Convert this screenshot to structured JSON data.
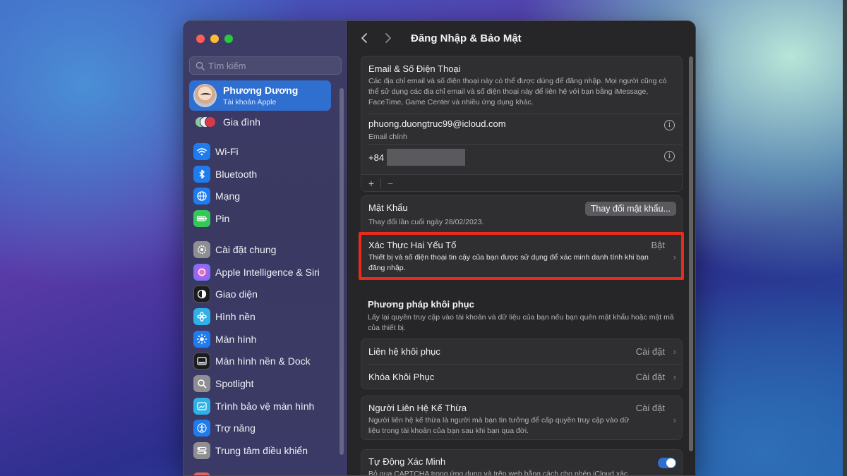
{
  "window": {
    "title": "Đăng Nhập & Bảo Mật"
  },
  "sidebar": {
    "search_placeholder": "Tìm kiếm",
    "account": {
      "name": "Phương Dương",
      "subtitle": "Tài khoản Apple"
    },
    "family_label": "Gia đình",
    "items": [
      {
        "label": "Wi-Fi",
        "icon": "wifi-icon"
      },
      {
        "label": "Bluetooth",
        "icon": "bluetooth-icon"
      },
      {
        "label": "Mạng",
        "icon": "globe-icon"
      },
      {
        "label": "Pin",
        "icon": "battery-icon"
      },
      {
        "label": "Cài đặt chung",
        "icon": "gear-icon"
      },
      {
        "label": "Apple Intelligence & Siri",
        "icon": "siri-icon"
      },
      {
        "label": "Giao diện",
        "icon": "appearance-icon"
      },
      {
        "label": "Hình nền",
        "icon": "wallpaper-icon"
      },
      {
        "label": "Màn hình",
        "icon": "display-icon"
      },
      {
        "label": "Màn hình nền & Dock",
        "icon": "dock-icon"
      },
      {
        "label": "Spotlight",
        "icon": "spotlight-icon"
      },
      {
        "label": "Trình bảo vệ màn hình",
        "icon": "screensaver-icon"
      },
      {
        "label": "Trợ năng",
        "icon": "accessibility-icon"
      },
      {
        "label": "Trung tâm điều khiển",
        "icon": "control-center-icon"
      }
    ]
  },
  "email_section": {
    "title": "Email & Số Điện Thoại",
    "description": "Các địa chỉ email và số điện thoại này có thể được dùng để đăng nhập. Mọi người cũng có thể sử dụng các địa chỉ email và số điện thoại này để liên hệ với bạn bằng iMessage, FaceTime, Game Center và nhiều ứng dụng khác.",
    "email": "phuong.duongtruc99@icloud.com",
    "email_label": "Email chính",
    "phone_prefix": "+84",
    "add": "+",
    "remove": "−"
  },
  "password": {
    "title": "Mật Khẩu",
    "description": "Thay đổi lần cuối ngày 28/02/2023.",
    "button": "Thay đổi mật khẩu..."
  },
  "two_factor": {
    "title": "Xác Thực Hai Yếu Tố",
    "status": "Bật",
    "description": "Thiết bị và số điện thoại tin cậy của bạn được sử dụng để xác minh danh tính khi bạn đăng nhập."
  },
  "recovery": {
    "title": "Phương pháp khôi phục",
    "description": "Lấy lại quyền truy cập vào tài khoản và dữ liệu của bạn nếu bạn quên mật khẩu hoặc mật mã của thiết bị.",
    "contact_label": "Liên hệ khôi phục",
    "contact_value": "Cài đặt",
    "key_label": "Khóa Khôi Phục",
    "key_value": "Cài đặt"
  },
  "legacy": {
    "title": "Người Liên Hệ Kế Thừa",
    "value": "Cài đặt",
    "description": "Người liên hệ kế thừa là người mà bạn tin tưởng để cấp quyền truy cập vào dữ liệu trong tài khoản của bạn sau khi bạn qua đời."
  },
  "auto_verify": {
    "title": "Tự Động Xác Minh",
    "description": "Bỏ qua CAPTCHA trong ứng dụng và trên web bằng cách cho phép iCloud xác",
    "enabled": true
  },
  "colors": {
    "accent": "#2f6fd0",
    "highlight": "#ea2a1a"
  }
}
